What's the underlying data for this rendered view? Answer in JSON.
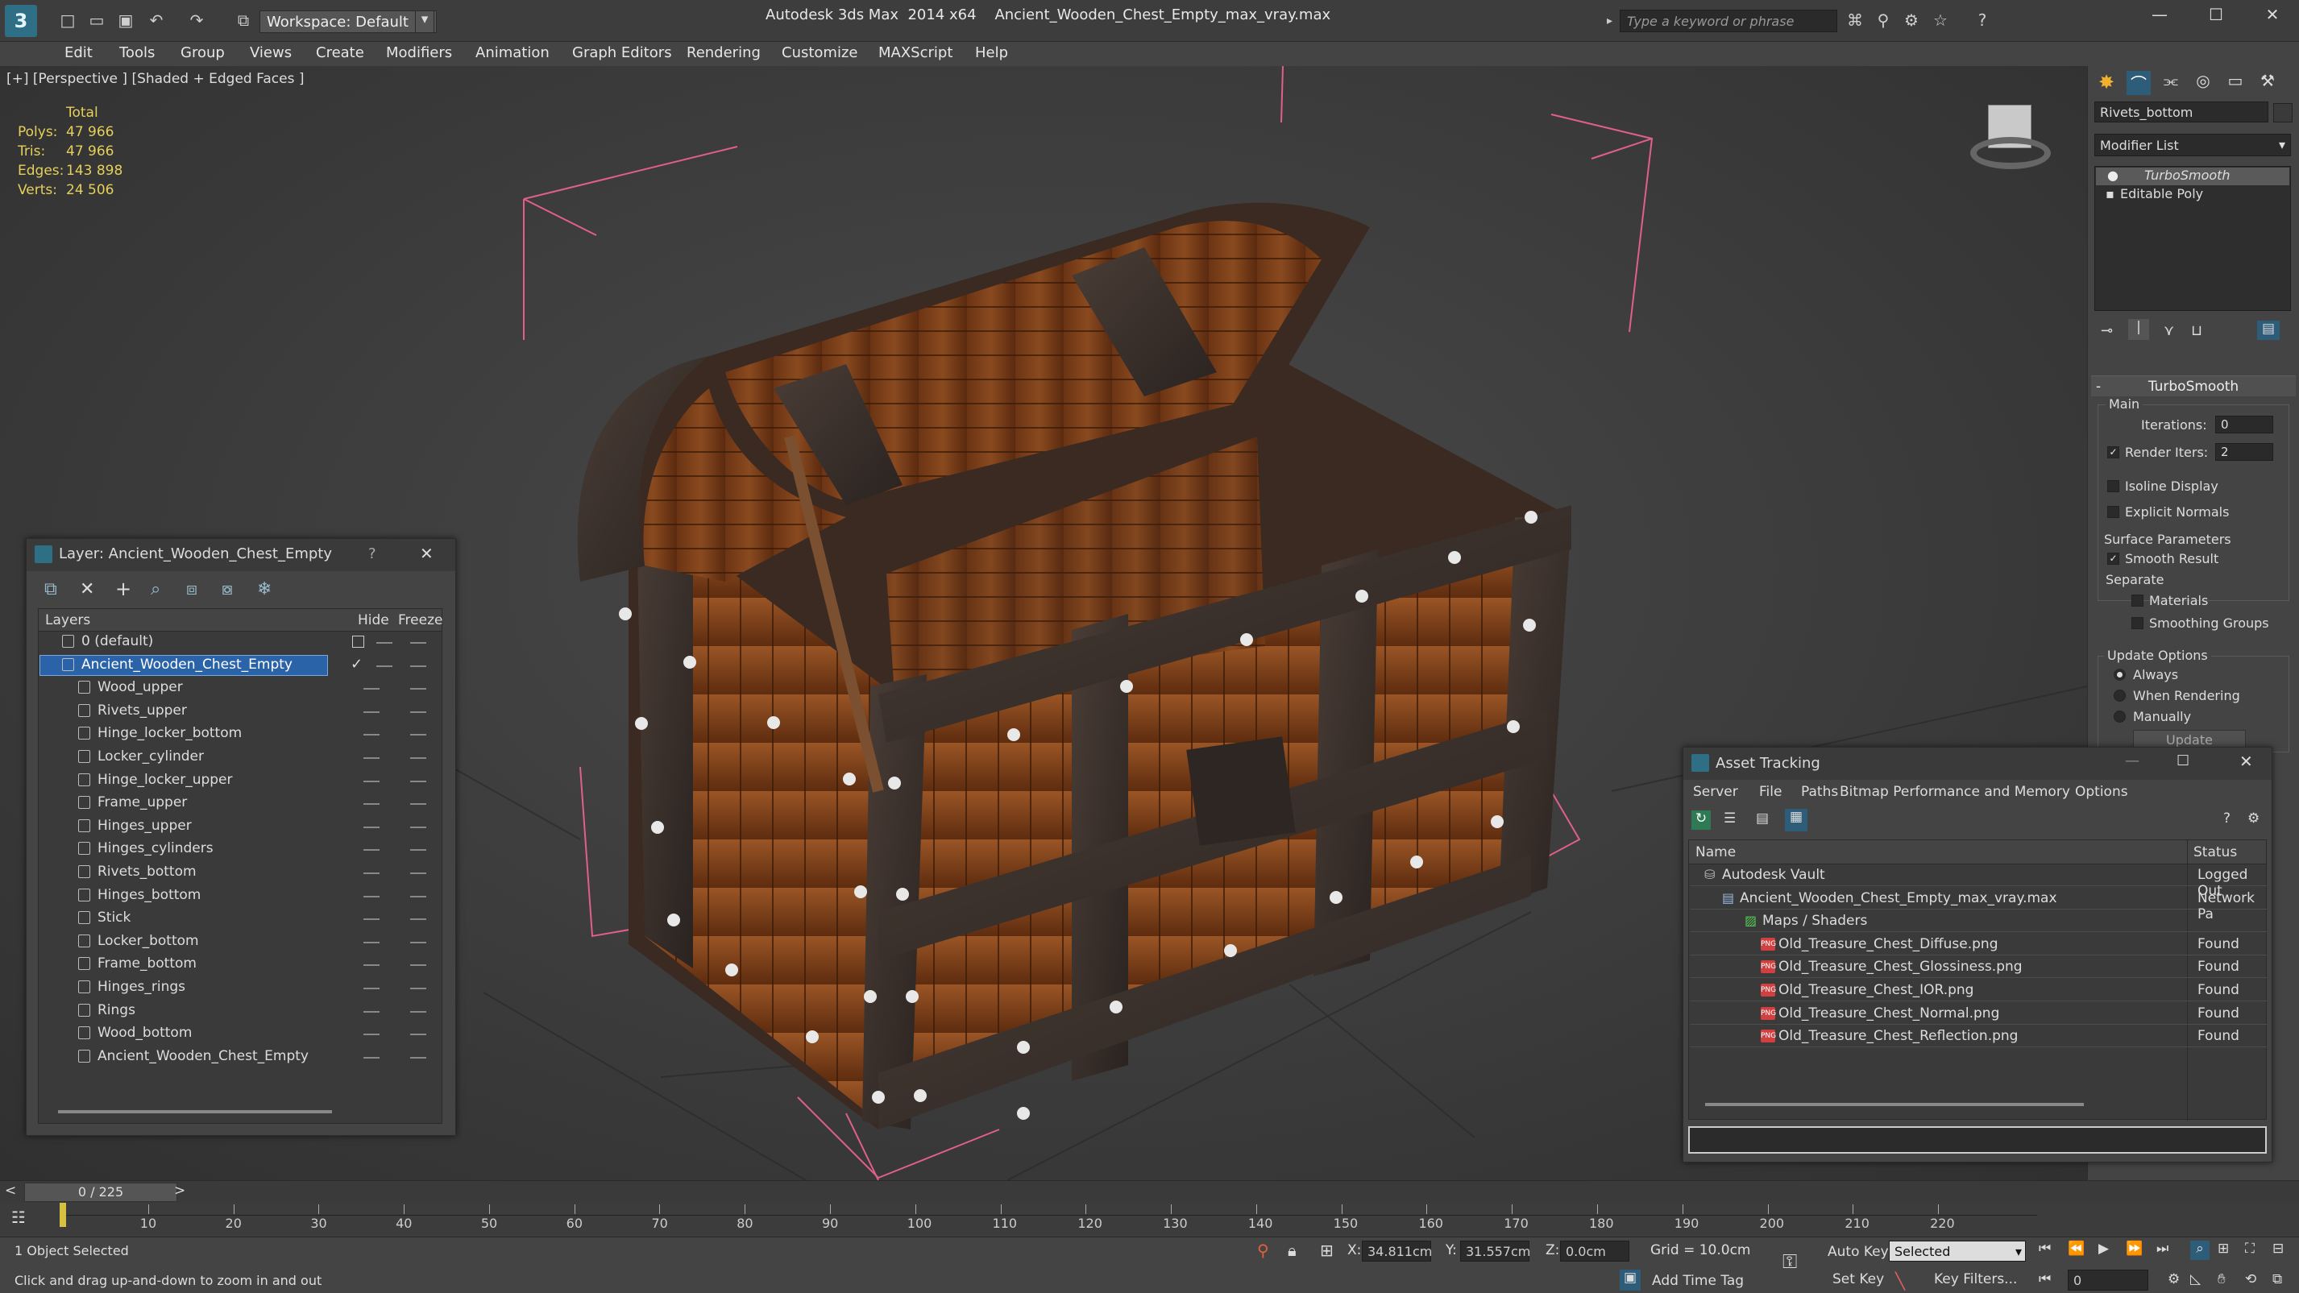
{
  "titlebar": {
    "app_title": "Autodesk 3ds Max  2014 x64",
    "file_title": "Ancient_Wooden_Chest_Empty_max_vray.max",
    "workspace": "Workspace: Default",
    "search_placeholder": "Type a keyword or phrase"
  },
  "menu": [
    "Edit",
    "Tools",
    "Group",
    "Views",
    "Create",
    "Modifiers",
    "Animation",
    "Graph Editors",
    "Rendering",
    "Customize",
    "MAXScript",
    "Help"
  ],
  "viewport": {
    "label": "[+] [Perspective ] [Shaded + Edged Faces ]",
    "stats_header": "Total",
    "stats": [
      {
        "label": "Polys:",
        "value": "47 966"
      },
      {
        "label": "Tris:",
        "value": "47 966"
      },
      {
        "label": "Edges:",
        "value": "143 898"
      },
      {
        "label": "Verts:",
        "value": "24 506"
      }
    ]
  },
  "command_panel": {
    "object_name": "Rivets_bottom",
    "modifier_list": "Modifier List",
    "stack": [
      "TurboSmooth",
      "Editable Poly"
    ],
    "rollout_title": "TurboSmooth",
    "main_label": "Main",
    "iterations_label": "Iterations:",
    "iterations_value": "0",
    "render_iters_label": "Render Iters:",
    "render_iters_value": "2",
    "isoline": "Isoline Display",
    "explicit_normals": "Explicit Normals",
    "surface_params": "Surface Parameters",
    "smooth_result": "Smooth Result",
    "separate": "Separate",
    "materials": "Materials",
    "smoothing_groups": "Smoothing Groups",
    "update_options": "Update Options",
    "always": "Always",
    "when_rendering": "When Rendering",
    "manually": "Manually",
    "update_btn": "Update"
  },
  "layer_dialog": {
    "title": "Layer: Ancient_Wooden_Chest_Empty",
    "help": "?",
    "col_layers": "Layers",
    "col_hide": "Hide",
    "col_freeze": "Freeze",
    "layers": [
      "0 (default)",
      "Ancient_Wooden_Chest_Empty"
    ],
    "objects": [
      "Wood_upper",
      "Rivets_upper",
      "Hinge_locker_bottom",
      "Locker_cylinder",
      "Hinge_locker_upper",
      "Frame_upper",
      "Hinges_upper",
      "Hinges_cylinders",
      "Rivets_bottom",
      "Hinges_bottom",
      "Stick",
      "Locker_bottom",
      "Frame_bottom",
      "Hinges_rings",
      "Rings",
      "Wood_bottom",
      "Ancient_Wooden_Chest_Empty"
    ]
  },
  "asset_dialog": {
    "title": "Asset Tracking",
    "menu": [
      "Server",
      "File",
      "Paths",
      "Bitmap Performance and Memory",
      "Options"
    ],
    "col_name": "Name",
    "col_status": "Status",
    "rows": [
      {
        "name": "Autodesk Vault",
        "status": "Logged Out"
      },
      {
        "name": "Ancient_Wooden_Chest_Empty_max_vray.max",
        "status": "Network Pa"
      },
      {
        "name": "Maps / Shaders",
        "status": ""
      },
      {
        "name": "Old_Treasure_Chest_Diffuse.png",
        "status": "Found"
      },
      {
        "name": "Old_Treasure_Chest_Glossiness.png",
        "status": "Found"
      },
      {
        "name": "Old_Treasure_Chest_IOR.png",
        "status": "Found"
      },
      {
        "name": "Old_Treasure_Chest_Normal.png",
        "status": "Found"
      },
      {
        "name": "Old_Treasure_Chest_Reflection.png",
        "status": "Found"
      }
    ]
  },
  "timeline": {
    "frame_counter": "0 / 225",
    "ticks": [
      "10",
      "20",
      "30",
      "40",
      "50",
      "60",
      "70",
      "80",
      "90",
      "100",
      "110",
      "120",
      "130",
      "140",
      "150",
      "160",
      "170",
      "180",
      "190",
      "200",
      "210",
      "220"
    ]
  },
  "statusbar": {
    "selected": "1 Object Selected",
    "prompt": "Click and drag up-and-down to zoom in and out",
    "x_label": "X:",
    "x_value": "34.811cm",
    "y_label": "Y:",
    "y_value": "31.557cm",
    "z_label": "Z:",
    "z_value": "0.0cm",
    "grid": "Grid = 10.0cm",
    "auto_key": "Auto Key",
    "set_key": "Set Key",
    "selected_dropdown": "Selected",
    "key_filters": "Key Filters...",
    "add_time_tag": "Add Time Tag",
    "frame": "0"
  }
}
